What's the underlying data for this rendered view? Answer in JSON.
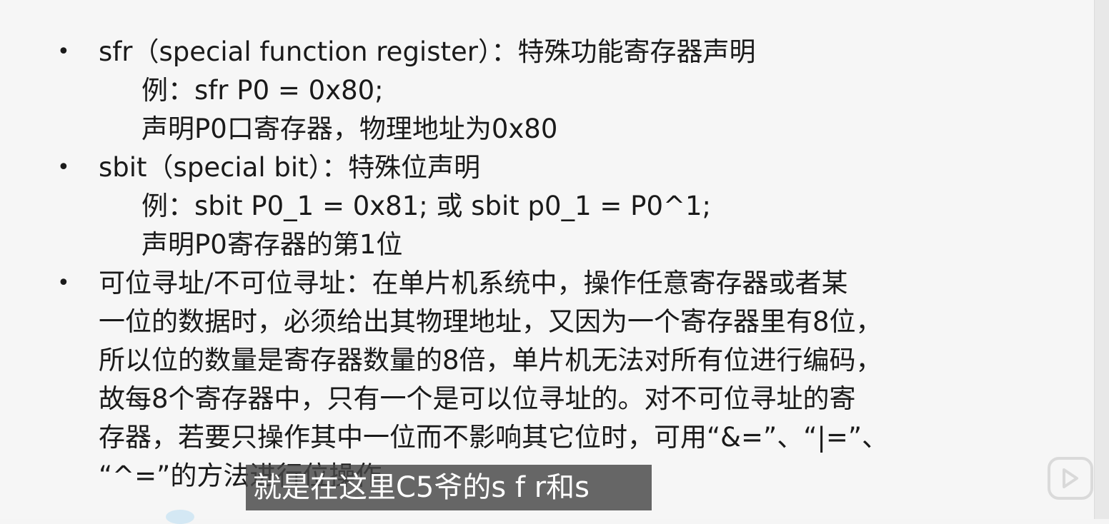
{
  "slide": {
    "bullets": [
      {
        "marker": "•",
        "lines": [
          "sfr（special function register）：特殊功能寄存器声明"
        ],
        "sub_lines": [
          "例：sfr P0 = 0x80;",
          "声明P0口寄存器，物理地址为0x80"
        ]
      },
      {
        "marker": "•",
        "lines": [
          "sbit（special bit）：特殊位声明"
        ],
        "sub_lines": [
          "例：sbit P0_1 = 0x81;    或    sbit p0_1 = P0^1;",
          "声明P0寄存器的第1位"
        ]
      },
      {
        "marker": "•",
        "lines": [
          "可位寻址/不可位寻址：在单片机系统中，操作任意寄存器或者某",
          "一位的数据时，必须给出其物理地址，又因为一个寄存器里有8位，",
          "所以位的数量是寄存器数量的8倍，单片机无法对所有位进行编码，",
          "故每8个寄存器中，只有一个是可以位寻址的。对不可位寻址的寄",
          "存器，若要只操作其中一位而不影响其它位时，可用“&=”、“|=”、",
          "“^=”的方法进行位操作"
        ]
      }
    ]
  },
  "subtitle": "就是在这里C5爷的s f r和s",
  "watermark_icon": "tv-play-icon"
}
